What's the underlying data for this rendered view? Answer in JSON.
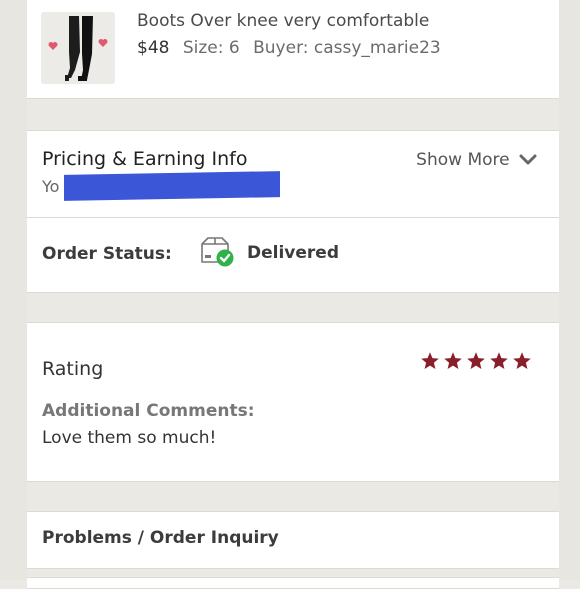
{
  "item": {
    "title": "Boots Over knee very comfortable",
    "price": "$48",
    "size": "Size: 6",
    "buyer": "Buyer: cassy_marie23",
    "thumbnail_icon": "boots-photo"
  },
  "pricing": {
    "title": "Pricing & Earning Info",
    "show_more": "Show More",
    "subtitle_visible": "Yo"
  },
  "order_status": {
    "label": "Order Status:",
    "value": "Delivered",
    "icon": "delivered-box-icon",
    "check_color": "#2fb24a"
  },
  "rating": {
    "label": "Rating",
    "stars": 5,
    "star_color": "#8a1f2c",
    "comments_label": "Additional Comments:",
    "comments_text": "Love them so much!"
  },
  "problems": {
    "label": "Problems / Order Inquiry"
  }
}
